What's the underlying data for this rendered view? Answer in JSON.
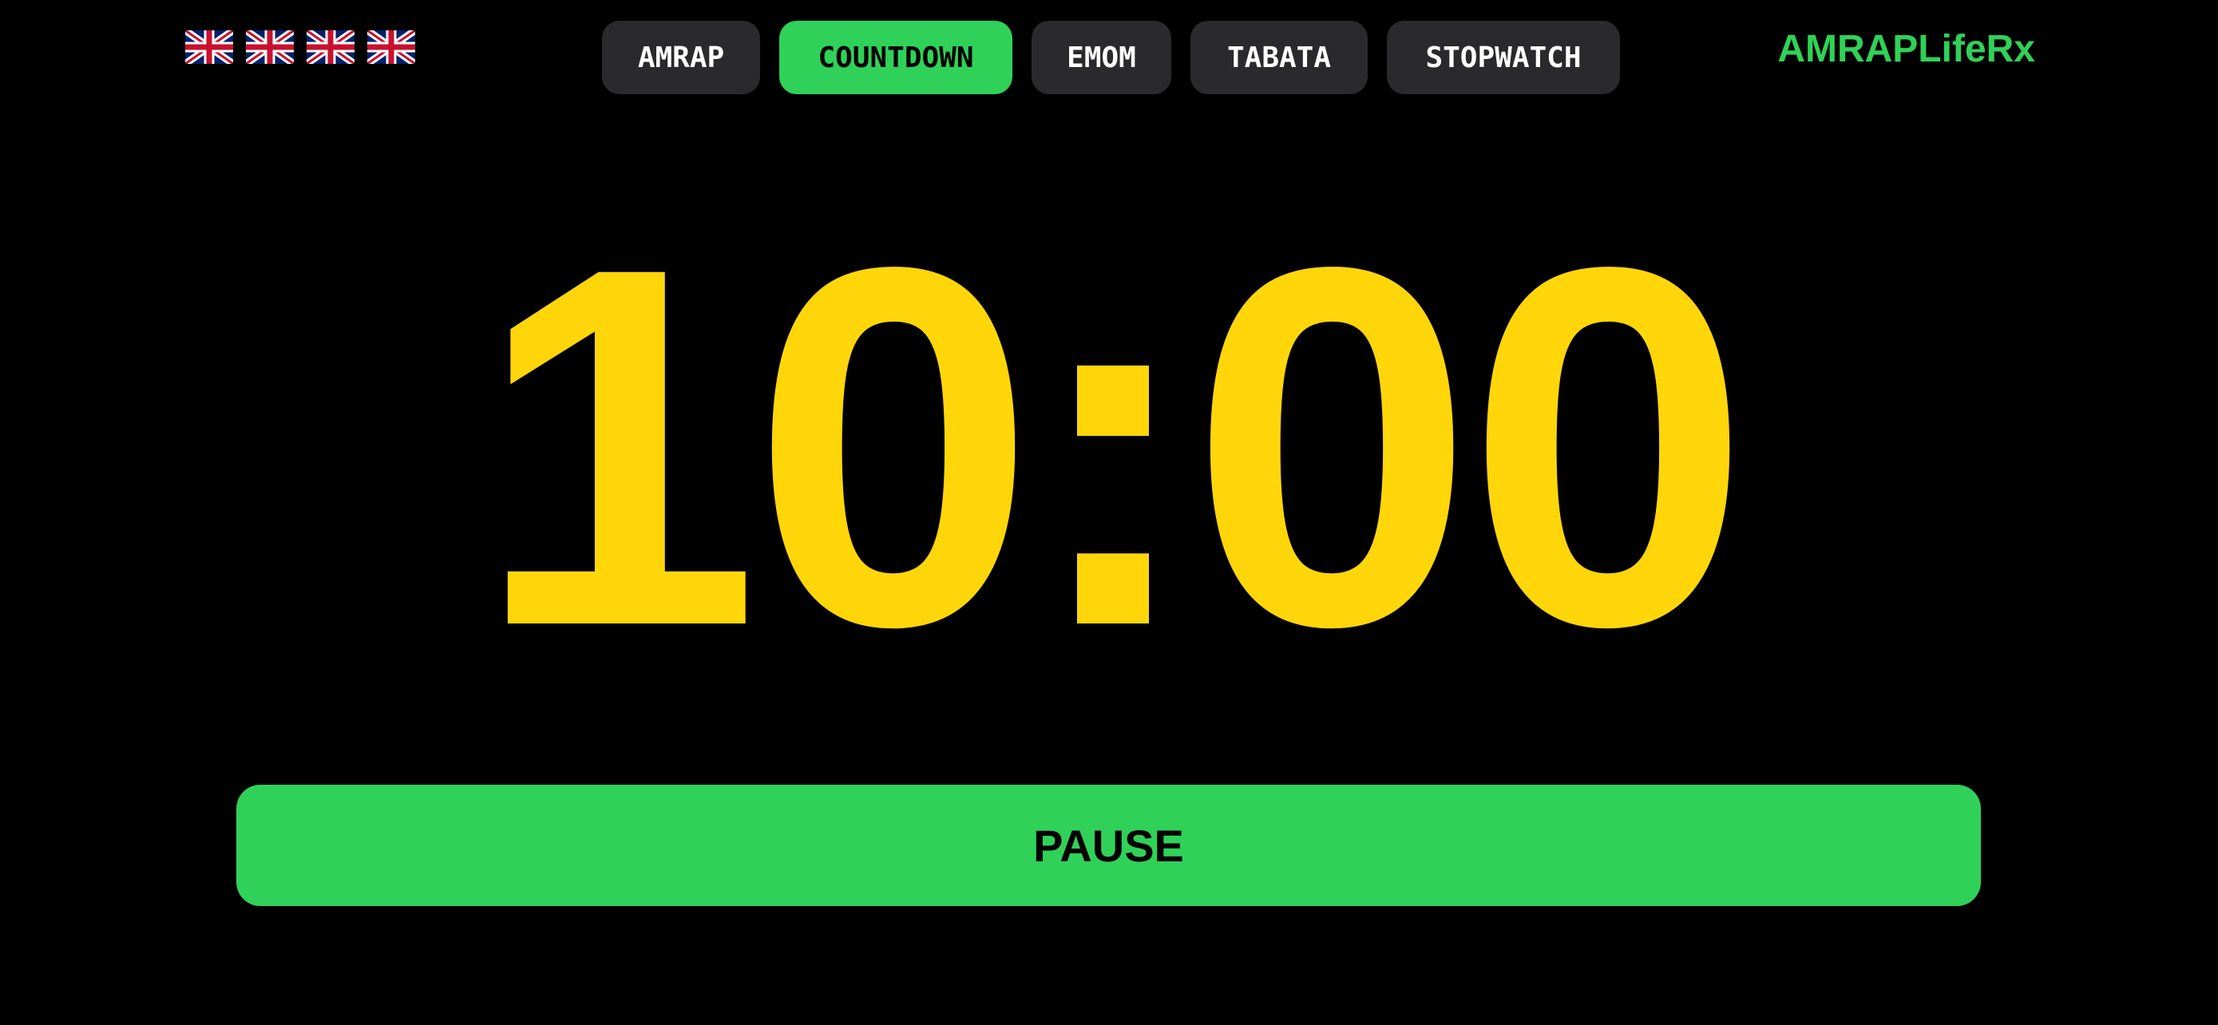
{
  "flags": [
    {
      "icon": "uk-flag-icon"
    },
    {
      "icon": "uk-flag-icon"
    },
    {
      "icon": "uk-flag-icon"
    },
    {
      "icon": "uk-flag-icon"
    }
  ],
  "tabs": [
    {
      "label": "AMRAP",
      "active": false
    },
    {
      "label": "COUNTDOWN",
      "active": true
    },
    {
      "label": "EMOM",
      "active": false
    },
    {
      "label": "TABATA",
      "active": false
    },
    {
      "label": "STOPWATCH",
      "active": false
    }
  ],
  "brand": {
    "label": "AMRAPLifeRx"
  },
  "timer": {
    "value": "10:00"
  },
  "controls": {
    "pause_label": "PAUSE"
  },
  "colors": {
    "background": "#000000",
    "accent": "#30d158",
    "timer": "#ffd60a",
    "tab_inactive": "#2a2a2c"
  }
}
